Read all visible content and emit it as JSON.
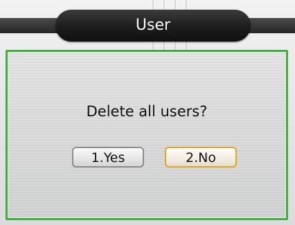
{
  "header": {
    "title": "User"
  },
  "dialog": {
    "message": "Delete all users?",
    "buttons": [
      {
        "label": "1.Yes",
        "selected": false
      },
      {
        "label": "2.No",
        "selected": true
      }
    ]
  },
  "colors": {
    "dialog_border": "#3fae3a",
    "selected_button_border": "#e0a52a",
    "title_bar": "#1c1c1c"
  }
}
